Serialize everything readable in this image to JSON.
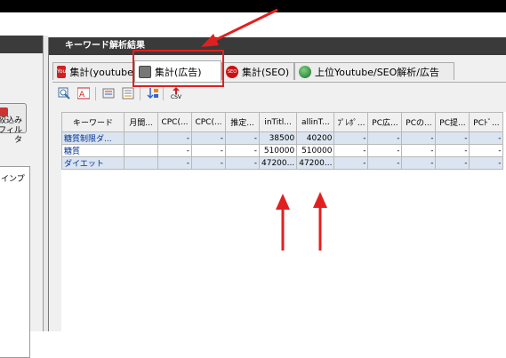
{
  "left_panel": {
    "filter_button": "絞込み\nフィルタ",
    "box_text": "インプ"
  },
  "window": {
    "title": "キーワード解析結果"
  },
  "tabs": [
    {
      "label": "集計(youtube)",
      "icon": "youtube-icon"
    },
    {
      "label": "集計(広告)",
      "icon": "ad-icon",
      "active": true
    },
    {
      "label": "集計(SEO)",
      "icon": "seo-icon"
    },
    {
      "label": "上位Youtube/SEO解析/広告",
      "icon": "globe-icon"
    }
  ],
  "toolbar": {
    "csv_label": "CSV"
  },
  "table": {
    "headers": [
      "キーワード",
      "月間...",
      "CPC(...",
      "CPC(...",
      "推定...",
      "inTitl...",
      "allinT...",
      "ﾌﾟﾚﾎﾟ...",
      "PC広...",
      "PCの...",
      "PC提...",
      "PCﾄﾞ..."
    ],
    "rows": [
      [
        "糖質制限ダ...",
        "",
        "-",
        "-",
        "-",
        "38500",
        "40200",
        "-",
        "-",
        "-",
        "-",
        "-"
      ],
      [
        "糖質",
        "",
        "-",
        "-",
        "-",
        "510000",
        "510000",
        "-",
        "-",
        "-",
        "-",
        "-"
      ],
      [
        "ダイエット",
        "",
        "-",
        "-",
        "-",
        "47200...",
        "47200...",
        "-",
        "-",
        "-",
        "-",
        "-"
      ]
    ]
  },
  "colors": {
    "highlight": "#e02020",
    "arrow": "#e02020",
    "row_alt": "#dbe5f1",
    "keyword_text": "#003399"
  }
}
